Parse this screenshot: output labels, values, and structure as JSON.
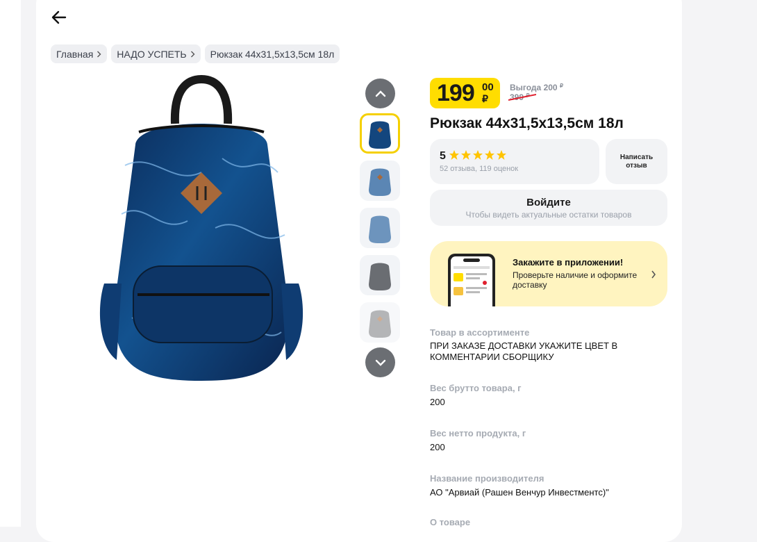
{
  "breadcrumbs": [
    "Главная",
    "НАДО УСПЕТЬ",
    "Рюкзак 44x31,5x13,5см 18л"
  ],
  "price": {
    "integer": "199",
    "decimal": "00",
    "currency": "₽"
  },
  "benefit": {
    "label": "Выгода",
    "amount": "200",
    "currency": "₽"
  },
  "old_price": {
    "amount": "399",
    "currency": "₽"
  },
  "product_title": "Рюкзак 44x31,5x13,5см 18л",
  "rating": {
    "value": "5",
    "stars": 5,
    "summary": "52 отзыва, 119 оценок"
  },
  "write_review": "Написать отзыв",
  "login": {
    "title": "Войдите",
    "subtitle": "Чтобы видеть актуальные остатки товаров"
  },
  "app_banner": {
    "title": "Закажите в приложении!",
    "subtitle": "Проверьте наличие и оформите доставку"
  },
  "specs": [
    {
      "label": "Товар в ассортименте",
      "value": "ПРИ ЗАКАЗЕ ДОСТАВКИ УКАЖИТЕ ЦВЕТ В КОММЕНТАРИИ СБОРЩИКУ"
    },
    {
      "label": "Вес брутто товара, г",
      "value": "200"
    },
    {
      "label": "Вес нетто продукта, г",
      "value": "200"
    },
    {
      "label": "Название производителя",
      "value": "АО \"Арвиай (Рашен Венчур Инвестментс)\""
    },
    {
      "label": "О товаре",
      "value": ""
    }
  ],
  "icons": {
    "back": "arrow-left-icon",
    "gallery_up": "chevron-up-icon",
    "gallery_down": "chevron-down-icon",
    "banner": "chevron-right-icon"
  },
  "colors": {
    "accent": "#ffdd00",
    "banner": "#fff4c0",
    "strike": "#e0202e",
    "star": "#ffc400"
  }
}
